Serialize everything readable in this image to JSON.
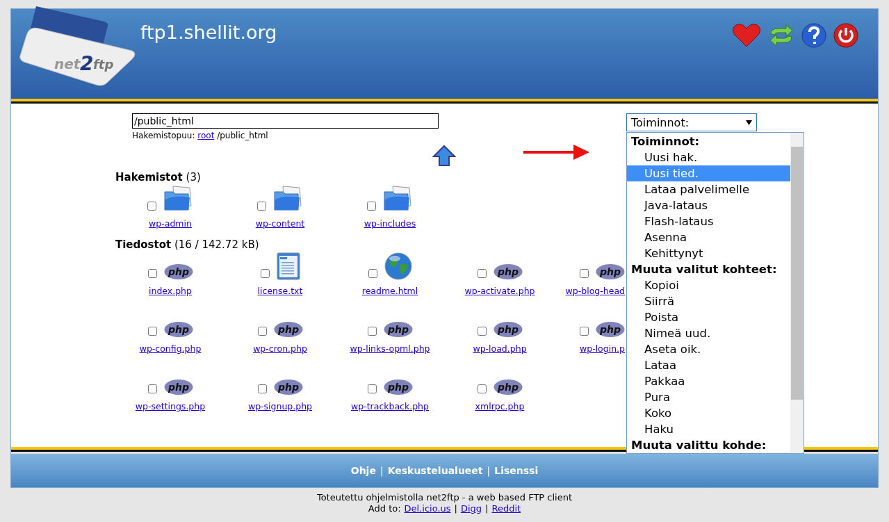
{
  "header": {
    "logo": {
      "text_1": "net",
      "text_2": "2",
      "text_3": "ftp"
    },
    "title": "ftp1.shellit.org"
  },
  "path": {
    "value": "/public_html",
    "breadcrumb_label": "Hakemistopuu:",
    "breadcrumb_link": "root",
    "breadcrumb_rest": "/public_html"
  },
  "actions_select": {
    "value": "Toiminnot:",
    "options": [
      {
        "kind": "group",
        "label": "Toiminnot:"
      },
      {
        "kind": "option",
        "label": "Uusi hak.",
        "selected": false
      },
      {
        "kind": "option",
        "label": "Uusi tied.",
        "selected": true
      },
      {
        "kind": "option",
        "label": "Lataa palvelimelle",
        "selected": false
      },
      {
        "kind": "option",
        "label": "Java-lataus",
        "selected": false
      },
      {
        "kind": "option",
        "label": "Flash-lataus",
        "selected": false
      },
      {
        "kind": "option",
        "label": "Asenna",
        "selected": false
      },
      {
        "kind": "option",
        "label": "Kehittynyt",
        "selected": false
      },
      {
        "kind": "group",
        "label": "Muuta valitut kohteet:"
      },
      {
        "kind": "option",
        "label": "Kopioi",
        "selected": false
      },
      {
        "kind": "option",
        "label": "Siirrä",
        "selected": false
      },
      {
        "kind": "option",
        "label": "Poista",
        "selected": false
      },
      {
        "kind": "option",
        "label": "Nimeä uud.",
        "selected": false
      },
      {
        "kind": "option",
        "label": "Aseta oik.",
        "selected": false
      },
      {
        "kind": "option",
        "label": "Lataa",
        "selected": false
      },
      {
        "kind": "option",
        "label": "Pakkaa",
        "selected": false
      },
      {
        "kind": "option",
        "label": "Pura",
        "selected": false
      },
      {
        "kind": "option",
        "label": "Koko",
        "selected": false
      },
      {
        "kind": "option",
        "label": "Haku",
        "selected": false
      },
      {
        "kind": "group",
        "label": "Muuta valittu kohde:"
      }
    ]
  },
  "directories": {
    "heading": "**Hakemistot** (3)",
    "items": [
      {
        "name": "wp-admin",
        "checked": false
      },
      {
        "name": "wp-content",
        "checked": false
      },
      {
        "name": "wp-includes",
        "checked": false
      }
    ]
  },
  "files": {
    "heading": "**Tiedostot** (16 / 142.72 kB)",
    "items": [
      {
        "name": "index.php",
        "kind": "php",
        "badge": "php",
        "checked": false
      },
      {
        "name": "license.txt",
        "kind": "text",
        "checked": false
      },
      {
        "name": "readme.html",
        "kind": "web",
        "checked": false
      },
      {
        "name": "wp-activate.php",
        "kind": "php",
        "badge": "php",
        "checked": false
      },
      {
        "name": "wp-blog-head",
        "kind": "php",
        "badge": "php",
        "checked": false
      },
      {
        "name": "wp-config.php",
        "kind": "php",
        "badge": "php",
        "checked": false
      },
      {
        "name": "wp-cron.php",
        "kind": "php",
        "badge": "php",
        "checked": false
      },
      {
        "name": "wp-links-opml.php",
        "kind": "php",
        "badge": "php",
        "checked": false
      },
      {
        "name": "wp-load.php",
        "kind": "php",
        "badge": "php",
        "checked": false
      },
      {
        "name": "wp-login.p",
        "kind": "php",
        "badge": "php",
        "checked": false
      },
      {
        "name": "wp-settings.php",
        "kind": "php",
        "badge": "php",
        "checked": false
      },
      {
        "name": "wp-signup.php",
        "kind": "php",
        "badge": "php",
        "checked": false
      },
      {
        "name": "wp-trackback.php",
        "kind": "php",
        "badge": "php",
        "checked": false
      },
      {
        "name": "xmlrpc.php",
        "kind": "php",
        "badge": "php",
        "checked": false
      }
    ]
  },
  "footer_links": [
    {
      "kind": "link",
      "text": "Ohje"
    },
    {
      "kind": "separator",
      "text": "|"
    },
    {
      "kind": "link",
      "text": "Keskustelualueet"
    },
    {
      "kind": "separator",
      "text": "|"
    },
    {
      "kind": "link",
      "text": "Lisenssi"
    }
  ],
  "credits": {
    "text": "Toteutettu ohjelmistolla net2ftp - a web based FTP client",
    "add_to_label": "Add to:",
    "links": [
      {
        "kind": "link",
        "text": "Del.icio.us"
      },
      {
        "kind": "separator",
        "text": "|"
      },
      {
        "kind": "link",
        "text": "Digg"
      },
      {
        "kind": "separator",
        "text": "|"
      },
      {
        "kind": "link",
        "text": "Reddit"
      }
    ]
  }
}
